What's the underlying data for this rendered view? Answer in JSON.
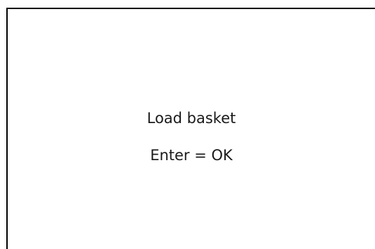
{
  "dialog": {
    "message": "Load basket",
    "instruction": "Enter = OK"
  }
}
